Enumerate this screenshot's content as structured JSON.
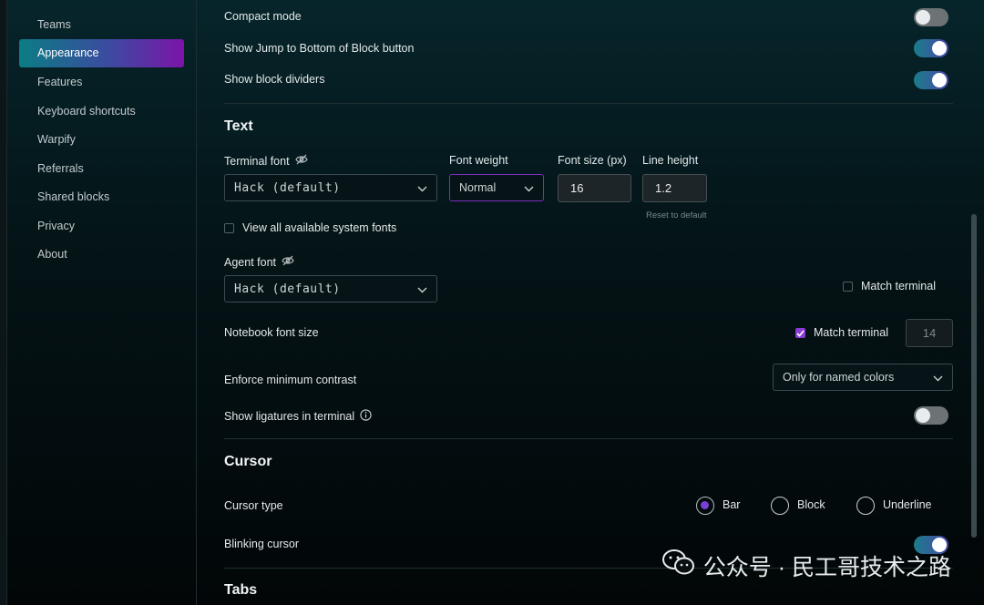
{
  "sidebar": {
    "items": [
      {
        "label": "Teams",
        "active": false
      },
      {
        "label": "Appearance",
        "active": true
      },
      {
        "label": "Features",
        "active": false
      },
      {
        "label": "Keyboard shortcuts",
        "active": false
      },
      {
        "label": "Warpify",
        "active": false
      },
      {
        "label": "Referrals",
        "active": false
      },
      {
        "label": "Shared blocks",
        "active": false
      },
      {
        "label": "Privacy",
        "active": false
      },
      {
        "label": "About",
        "active": false
      }
    ]
  },
  "settings": {
    "compact_mode": {
      "label": "Compact mode",
      "enabled": false
    },
    "jump_to_bottom": {
      "label": "Show Jump to Bottom of Block button",
      "enabled": true
    },
    "block_dividers": {
      "label": "Show block dividers",
      "enabled": true
    }
  },
  "text_section": {
    "title": "Text",
    "terminal_font": {
      "label": "Terminal font",
      "value": "Hack (default)"
    },
    "font_weight": {
      "label": "Font weight",
      "value": "Normal"
    },
    "font_size": {
      "label": "Font size (px)",
      "value": "16"
    },
    "line_height": {
      "label": "Line height",
      "value": "1.2",
      "reset_label": "Reset to default"
    },
    "view_system_fonts": {
      "label": "View all available system fonts",
      "checked": false
    },
    "agent_font": {
      "label": "Agent font",
      "value": "Hack (default)",
      "match_terminal_label": "Match terminal",
      "match_terminal_checked": false
    },
    "notebook_font_size": {
      "label": "Notebook font size",
      "match_terminal_label": "Match terminal",
      "match_terminal_checked": true,
      "value": "14"
    },
    "min_contrast": {
      "label": "Enforce minimum contrast",
      "value": "Only for named colors"
    },
    "ligatures": {
      "label": "Show ligatures in terminal",
      "enabled": false
    }
  },
  "cursor_section": {
    "title": "Cursor",
    "cursor_type": {
      "label": "Cursor type",
      "options": [
        "Bar",
        "Block",
        "Underline"
      ],
      "selected": "Bar"
    },
    "blinking": {
      "label": "Blinking cursor",
      "enabled": true
    }
  },
  "tabs_section": {
    "title": "Tabs"
  },
  "watermark": {
    "text": "公众号 · 民工哥技术之路"
  },
  "icons": {
    "hidden": "eye-off-icon",
    "info": "info-icon",
    "chevron": "chevron-down-icon",
    "wechat": "wechat-icon"
  },
  "colors": {
    "accent_start": "#0b7d84",
    "accent_end": "#7c14a9",
    "toggle_on": "#4a48a8",
    "checkbox": "#8a3bd6"
  }
}
